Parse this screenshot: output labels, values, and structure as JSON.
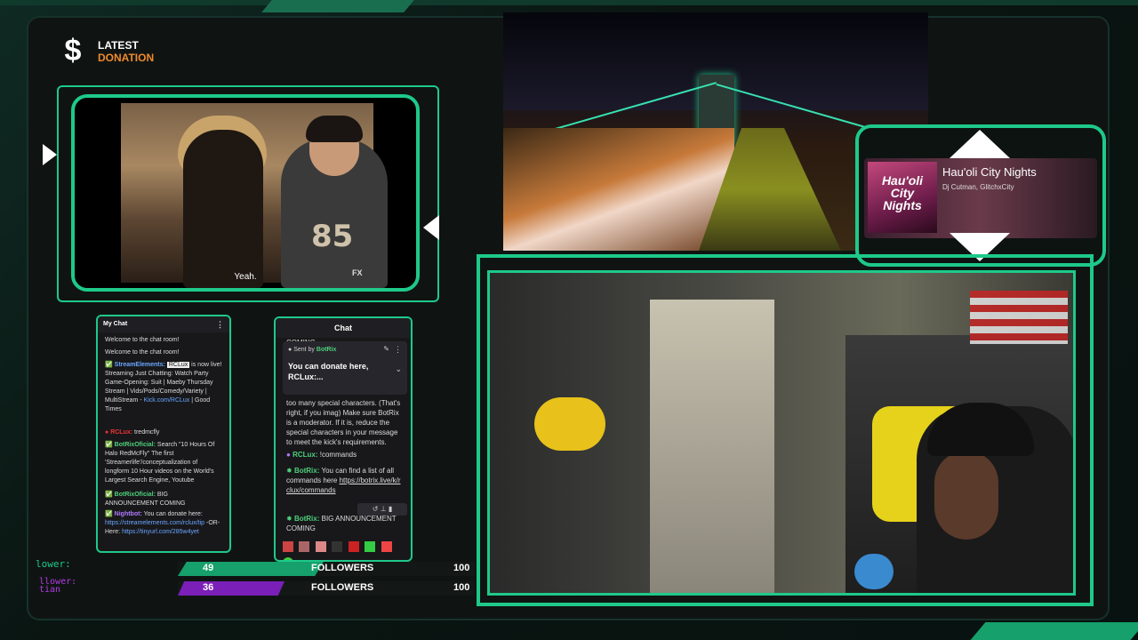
{
  "donation": {
    "latest": "LATEST",
    "label": "DONATION"
  },
  "video": {
    "subtitle": "Yeah.",
    "network": "FX",
    "jersey": "85"
  },
  "music": {
    "album_text": "Hau'oli City Nights",
    "title": "Hau'oli City Nights",
    "artist": "Dj Cutman, GlitchxCity"
  },
  "my_chat": {
    "title": "My Chat",
    "lines": [
      "Welcome to the chat room!",
      "Welcome to the chat room!"
    ],
    "msg1": {
      "user": "StreamElements:",
      "tag": "RCLux",
      "text": " is now live! Streaming Just Chatting: Watch Party Game-Opening: Suit | Maeby Thursday Stream | Vids/Pods/Comedy/Variety | MultiStream - ",
      "link": "Kick.com/RCLux",
      "tail": " | Good Times"
    },
    "msg2": {
      "user": "RCLux:",
      "text": " tredmcfly"
    },
    "msg3": {
      "user": "BotRixOficial:",
      "text": " Search \"10 Hours Of Halo RedMcFly\" The first 'Streamerlife'/conceptualization of longform 10 Hour videos on the World's Largest Search Engine, Youtube"
    },
    "msg4": {
      "user": "BotRixOficial:",
      "text": " BIG ANNOUNCEMENT COMING"
    },
    "msg5": {
      "user": "Nightbot:",
      "text": " You can donate here: ",
      "link": "https://streamelements.com/rclux/tip",
      "mid": " -OR- Here: ",
      "link2": "https://tinyurl.com/285w4yet"
    }
  },
  "chat2": {
    "title": "Chat",
    "top": "COMING",
    "pin_sent": "Sent by",
    "pin_user": "BotRix",
    "pin_text": "You can donate here, RCLux:...",
    "msg_a": "too many special characters. (That's right, if you imag) Make sure BotRix is a moderator. If it is, reduce the special characters in your message to meet the kick's requirements.",
    "msg_b_user": "RCLux:",
    "msg_b_text": " !commands",
    "msg_c_user": "BotRix:",
    "msg_c_text": " You can find a list of all commands here ",
    "msg_c_link": "https://botrix.live/k/rclux/commands",
    "msg_d_user": "BotRix:",
    "msg_d_text": " BIG ANNOUNCEMENT COMING"
  },
  "bars": [
    {
      "current": "49",
      "label": "FOLLOWERS",
      "goal": "100",
      "color": "#16a06b",
      "fraction": 0.49
    },
    {
      "current": "36",
      "label": "FOLLOWERS",
      "goal": "100",
      "color": "#7a1fb8",
      "fraction": 0.36
    }
  ],
  "lower": {
    "l1": "lower:",
    "l2a": "llower:",
    "l2b": "tian"
  }
}
